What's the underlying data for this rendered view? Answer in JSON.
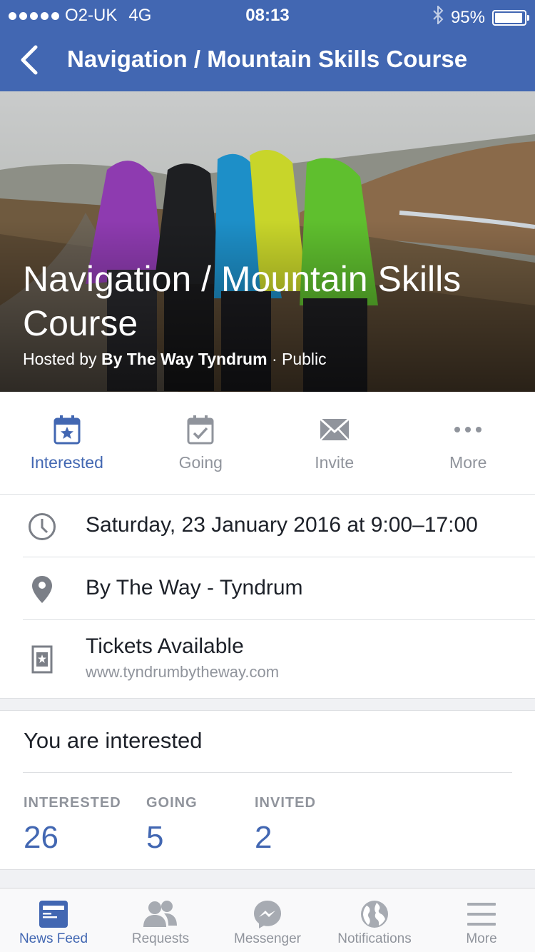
{
  "status_bar": {
    "carrier": "O2-UK",
    "network": "4G",
    "time": "08:13",
    "battery": "95%",
    "battery_level": 0.95
  },
  "nav": {
    "title": "Navigation / Mountain Skills Course",
    "bg_color": "#4267b2"
  },
  "hero": {
    "title": "Navigation / Mountain Skills Course",
    "hosted_prefix": "Hosted by",
    "host": "By The Way Tyndrum",
    "privacy": "· Public"
  },
  "actions": [
    {
      "label": "Interested",
      "icon": "calendar-star-icon",
      "active": true
    },
    {
      "label": "Going",
      "icon": "calendar-check-icon",
      "active": false
    },
    {
      "label": "Invite",
      "icon": "envelope-icon",
      "active": false
    },
    {
      "label": "More",
      "icon": "more-dots-icon",
      "active": false
    }
  ],
  "details": {
    "datetime": "Saturday, 23 January 2016 at 9:00–17:00",
    "location": "By The Way - Tyndrum",
    "tickets": "Tickets Available",
    "ticket_url": "www.tyndrumbytheway.com"
  },
  "interest": {
    "title": "You are interested",
    "stats": [
      {
        "label": "INTERESTED",
        "value": "26"
      },
      {
        "label": "GOING",
        "value": "5"
      },
      {
        "label": "INVITED",
        "value": "2"
      }
    ]
  },
  "tabbar": [
    {
      "label": "News Feed",
      "icon": "news-feed-icon",
      "active": true
    },
    {
      "label": "Requests",
      "icon": "friend-requests-icon",
      "active": false
    },
    {
      "label": "Messenger",
      "icon": "messenger-icon",
      "active": false
    },
    {
      "label": "Notifications",
      "icon": "globe-icon",
      "active": false
    },
    {
      "label": "More",
      "icon": "hamburger-menu-icon",
      "active": false
    }
  ],
  "colors": {
    "accent": "#4267b2",
    "muted": "#90949c",
    "text": "#1d2129",
    "divider": "#dddfe2"
  }
}
